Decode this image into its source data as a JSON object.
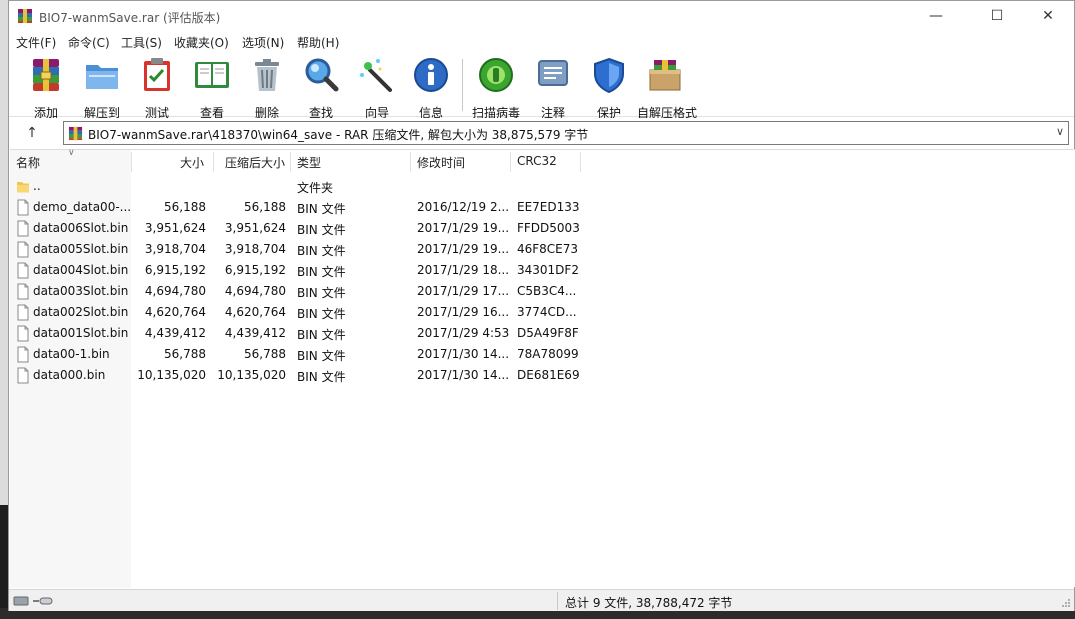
{
  "window": {
    "title": "BIO7-wanmSave.rar (评估版本)",
    "minimize": "—",
    "maximize": "☐",
    "close": "✕"
  },
  "menu": [
    "文件(F)",
    "命令(C)",
    "工具(S)",
    "收藏夹(O)",
    "选项(N)",
    "帮助(H)"
  ],
  "toolbar": [
    {
      "label": "添加",
      "icon": "add-archive-icon"
    },
    {
      "label": "解压到",
      "icon": "extract-folder-icon"
    },
    {
      "label": "测试",
      "icon": "test-clipboard-icon"
    },
    {
      "label": "查看",
      "icon": "view-book-icon"
    },
    {
      "label": "删除",
      "icon": "trash-bin-icon"
    },
    {
      "label": "查找",
      "icon": "magnifier-icon"
    },
    {
      "label": "向导",
      "icon": "wizard-wand-icon"
    },
    {
      "label": "信息",
      "icon": "info-icon"
    },
    {
      "label": "扫描病毒",
      "icon": "virus-scan-icon"
    },
    {
      "label": "注释",
      "icon": "comment-icon"
    },
    {
      "label": "保护",
      "icon": "shield-icon"
    },
    {
      "label": "自解压格式",
      "icon": "sfx-box-icon"
    }
  ],
  "address": {
    "up": "↑",
    "path": "BIO7-wanmSave.rar\\418370\\win64_save - RAR 压缩文件, 解包大小为 38,875,579 字节",
    "dropdown": "∨"
  },
  "columns": {
    "name": "名称",
    "size": "大小",
    "packed": "压缩后大小",
    "type": "类型",
    "modified": "修改时间",
    "crc": "CRC32"
  },
  "files": [
    {
      "name": "..",
      "size": "",
      "packed": "",
      "type": "文件夹",
      "modified": "",
      "crc": "",
      "kind": "folder"
    },
    {
      "name": "demo_data00-...",
      "size": "56,188",
      "packed": "56,188",
      "type": "BIN 文件",
      "modified": "2016/12/19 2...",
      "crc": "EE7ED133",
      "kind": "file"
    },
    {
      "name": "data006Slot.bin",
      "size": "3,951,624",
      "packed": "3,951,624",
      "type": "BIN 文件",
      "modified": "2017/1/29 19...",
      "crc": "FFDD5003",
      "kind": "file"
    },
    {
      "name": "data005Slot.bin",
      "size": "3,918,704",
      "packed": "3,918,704",
      "type": "BIN 文件",
      "modified": "2017/1/29 19...",
      "crc": "46F8CE73",
      "kind": "file"
    },
    {
      "name": "data004Slot.bin",
      "size": "6,915,192",
      "packed": "6,915,192",
      "type": "BIN 文件",
      "modified": "2017/1/29 18...",
      "crc": "34301DF2",
      "kind": "file"
    },
    {
      "name": "data003Slot.bin",
      "size": "4,694,780",
      "packed": "4,694,780",
      "type": "BIN 文件",
      "modified": "2017/1/29 17...",
      "crc": "C5B3C4...",
      "kind": "file"
    },
    {
      "name": "data002Slot.bin",
      "size": "4,620,764",
      "packed": "4,620,764",
      "type": "BIN 文件",
      "modified": "2017/1/29 16...",
      "crc": "3774CD...",
      "kind": "file"
    },
    {
      "name": "data001Slot.bin",
      "size": "4,439,412",
      "packed": "4,439,412",
      "type": "BIN 文件",
      "modified": "2017/1/29 4:53",
      "crc": "D5A49F8F",
      "kind": "file"
    },
    {
      "name": "data00-1.bin",
      "size": "56,788",
      "packed": "56,788",
      "type": "BIN 文件",
      "modified": "2017/1/30 14...",
      "crc": "78A78099",
      "kind": "file"
    },
    {
      "name": "data000.bin",
      "size": "10,135,020",
      "packed": "10,135,020",
      "type": "BIN 文件",
      "modified": "2017/1/30 14...",
      "crc": "DE681E69",
      "kind": "file"
    }
  ],
  "status": {
    "summary": "总计 9 文件, 38,788,472 字节"
  }
}
